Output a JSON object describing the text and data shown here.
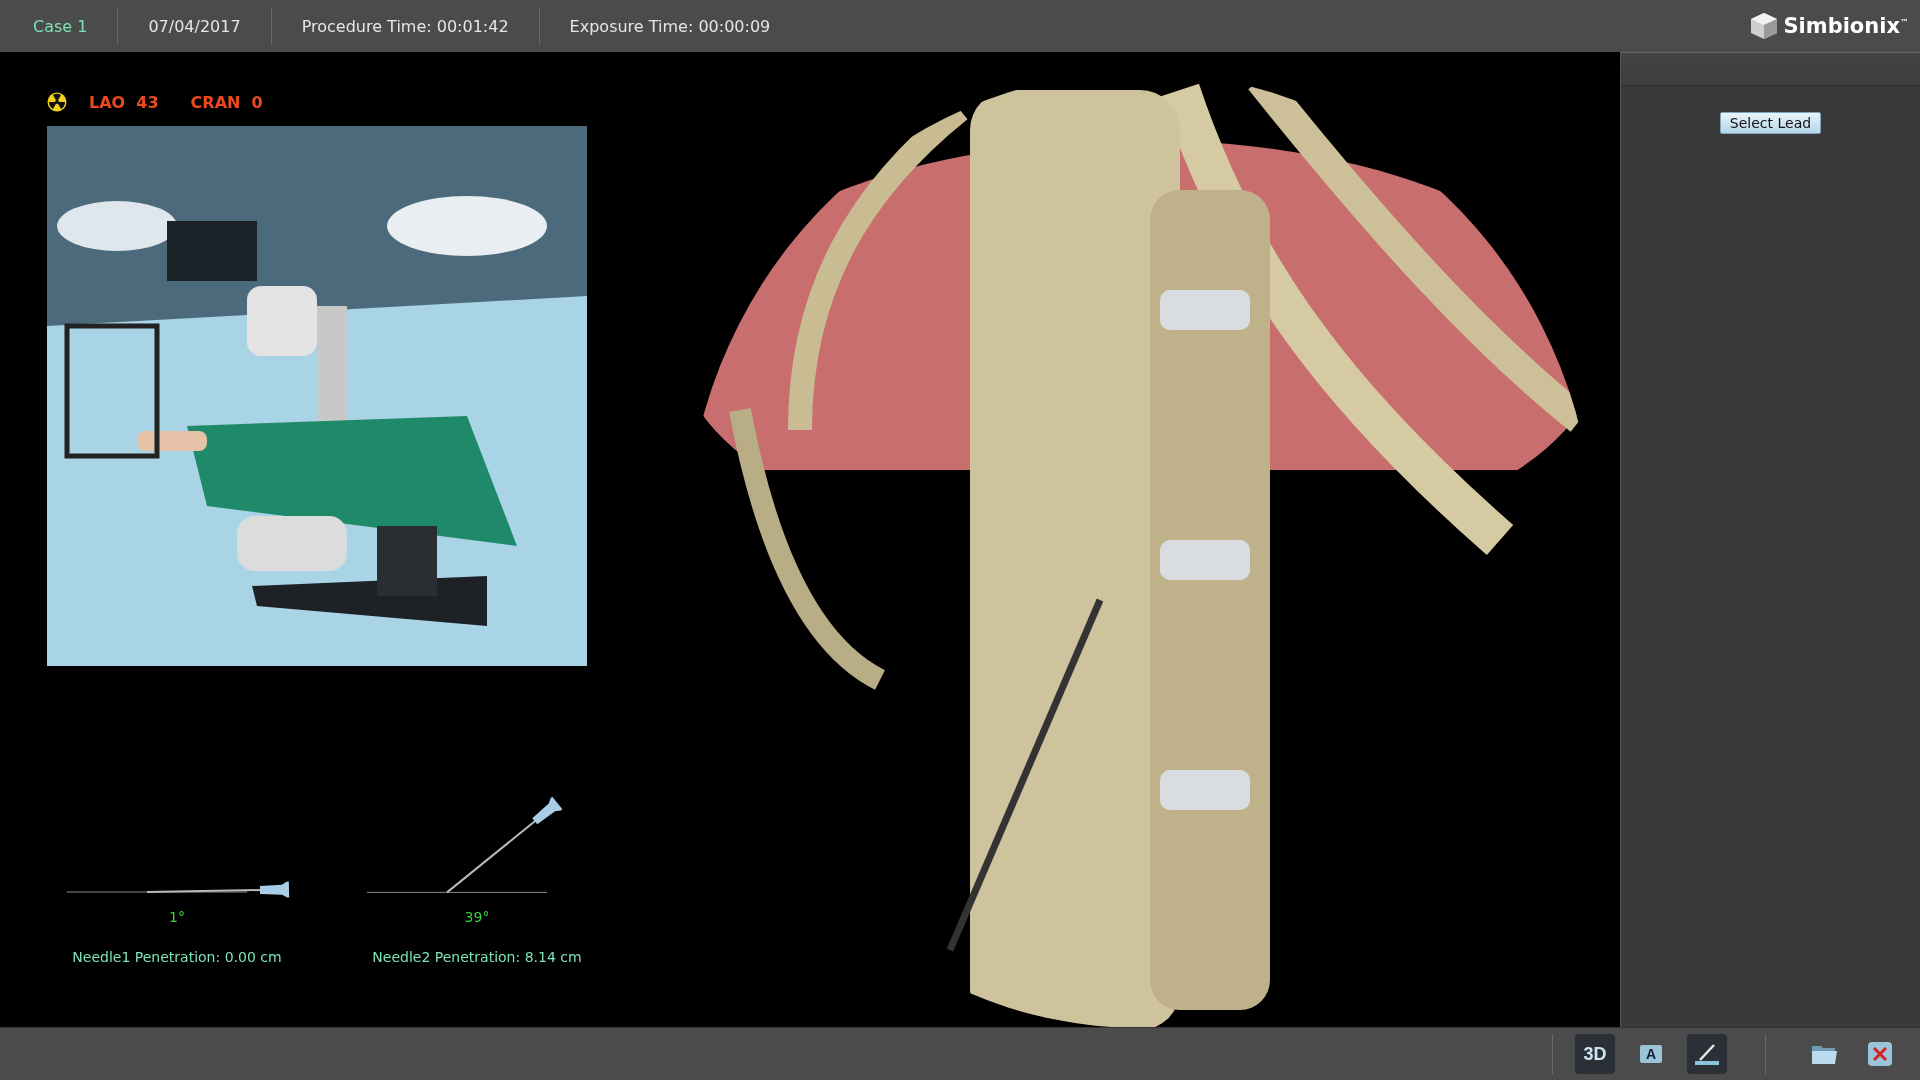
{
  "header": {
    "case": "Case 1",
    "date": "07/04/2017",
    "procedure_time": "Procedure Time: 00:01:42",
    "exposure_time": "Exposure Time: 00:00:09",
    "logo": "Simbionix$^{™}$"
  },
  "angles": [
    {
      "label": "LAO",
      "value": "43"
    },
    {
      "label": "CRAN",
      "value": "0"
    }
  ],
  "needles": [
    {
      "angle": "1°",
      "penetration": "Needle1 Penetration: 0.00 cm"
    },
    {
      "angle": "39°",
      "penetration": "Needle2 Penetration: 8.14 cm"
    }
  ],
  "side_panel": {
    "button": "Select Lead"
  },
  "toolbar": [
    {
      "kind": "view",
      "label": "3D",
      "selected": true
    },
    {
      "kind": "annotate",
      "label": "A",
      "selected": false
    },
    {
      "kind": "needle",
      "selected": true
    },
    {
      "kind": "separator"
    },
    {
      "kind": "open",
      "selected": false
    },
    {
      "kind": "close",
      "selected": false
    }
  ]
}
